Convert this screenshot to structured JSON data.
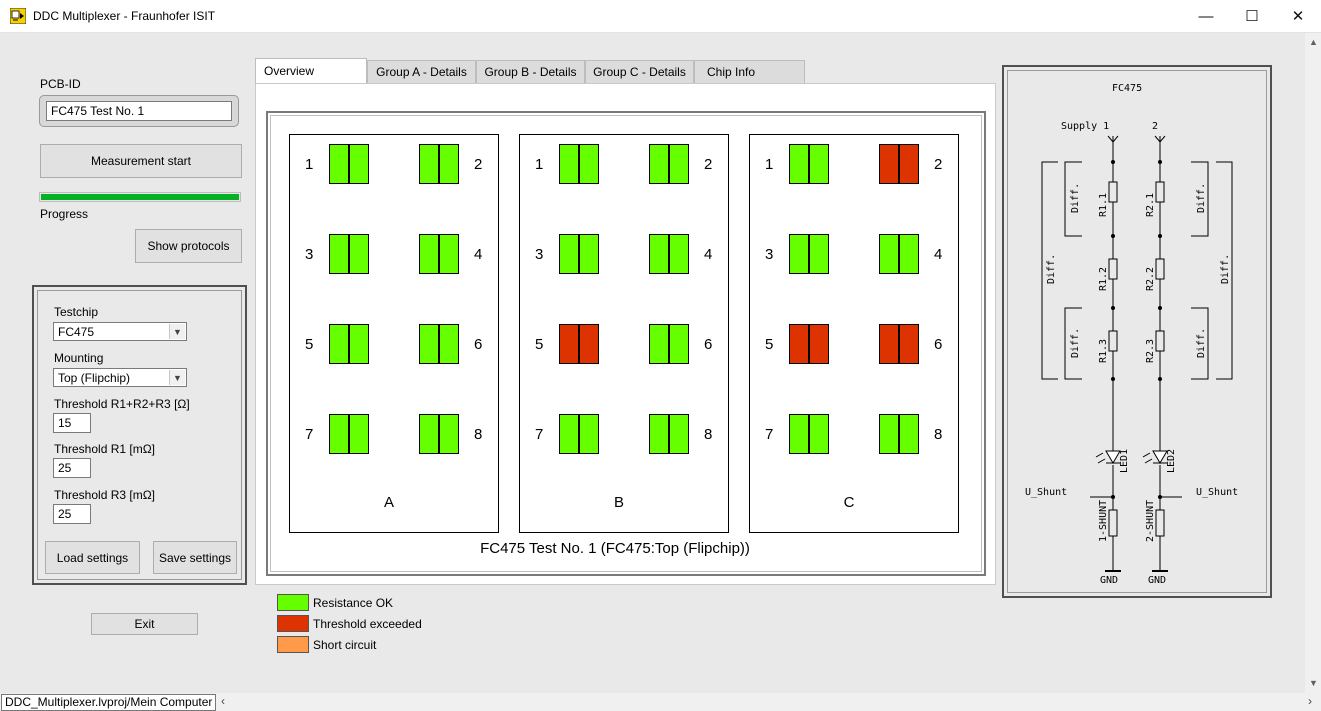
{
  "window": {
    "title": "DDC Multiplexer - Fraunhofer ISIT",
    "minimize": "—",
    "maximize": "☐",
    "close": "✕"
  },
  "left": {
    "pcb_label": "PCB-ID",
    "pcb_value": "FC475 Test No. 1",
    "measure_button": "Measurement start",
    "progress_label": "Progress",
    "progress": 1.0,
    "protocols_button": "Show protocols"
  },
  "settings": {
    "testchip_label": "Testchip",
    "testchip_value": "FC475",
    "mounting_label": "Mounting",
    "mounting_value": "Top (Flipchip)",
    "thr_total_label": "Threshold R1+R2+R3 [Ω]",
    "thr_total_value": "15",
    "thr_r1_label": "Threshold R1 [mΩ]",
    "thr_r1_value": "25",
    "thr_r3_label": "Threshold R3 [mΩ]",
    "thr_r3_value": "25",
    "load_button": "Load settings",
    "save_button": "Save settings"
  },
  "exit_button": "Exit",
  "tabs": [
    "Overview",
    "Group A - Details",
    "Group B - Details",
    "Group C - Details",
    "Chip Info"
  ],
  "overview": {
    "caption": "FC475 Test No. 1 (FC475:Top (Flipchip))",
    "groups": [
      {
        "name": "A",
        "status": [
          "ok",
          "ok",
          "ok",
          "ok",
          "ok",
          "ok",
          "ok",
          "ok"
        ]
      },
      {
        "name": "B",
        "status": [
          "ok",
          "ok",
          "ok",
          "ok",
          "fail",
          "ok",
          "ok",
          "ok"
        ]
      },
      {
        "name": "C",
        "status": [
          "ok",
          "fail",
          "ok",
          "ok",
          "fail",
          "fail",
          "ok",
          "ok"
        ]
      }
    ],
    "numbers": [
      "1",
      "2",
      "3",
      "4",
      "5",
      "6",
      "7",
      "8"
    ]
  },
  "colors": {
    "ok": "#66ff00",
    "fail": "#dd3300",
    "short": "#ff9a4a",
    "progress": "#06b025"
  },
  "legend": [
    {
      "key": "ok",
      "label": "Resistance OK"
    },
    {
      "key": "fail",
      "label": "Threshold exceeded"
    },
    {
      "key": "short",
      "label": "Short circuit"
    }
  ],
  "schematic": {
    "title": "FC475",
    "supply1": "Supply 1",
    "supply2": "2",
    "r11": "R1.1",
    "r12": "R1.2",
    "r13": "R1.3",
    "r21": "R2.1",
    "r22": "R2.2",
    "r23": "R2.3",
    "diff": "Diff.",
    "led1": "LED1",
    "led2": "LED2",
    "ushunt": "U_Shunt",
    "shunt1": "1-SHUNT",
    "shunt2": "2-SHUNT",
    "gnd": "GND"
  },
  "statusbar": {
    "path": "DDC_Multiplexer.lvproj/Mein Computer"
  }
}
